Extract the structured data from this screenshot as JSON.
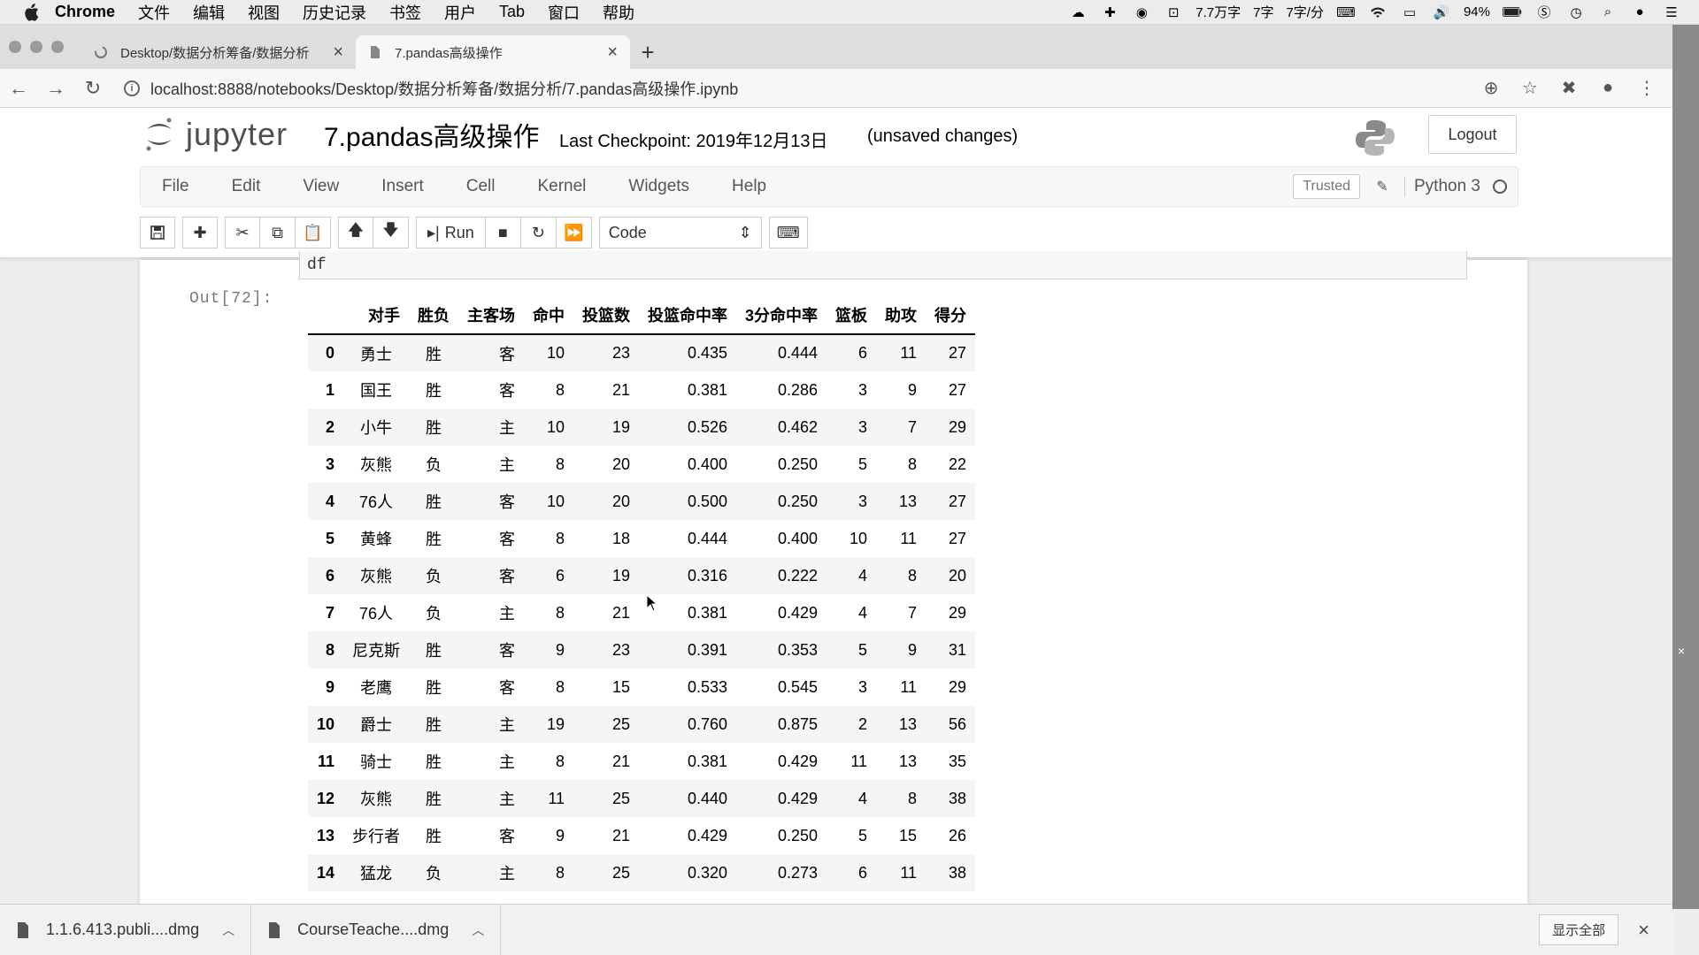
{
  "mac_menubar": {
    "app_name": "Chrome",
    "items": [
      "文件",
      "编辑",
      "视图",
      "历史记录",
      "书签",
      "用户",
      "Tab",
      "窗口",
      "帮助"
    ],
    "status": {
      "words_total": "7.7万字",
      "words_count": "7字",
      "words_rate": "7字/分",
      "battery": "94%"
    }
  },
  "browser": {
    "tabs": [
      {
        "title": "Desktop/数据分析筹备/数据分析",
        "active": false
      },
      {
        "title": "7.pandas高级操作",
        "active": true
      }
    ],
    "url": "localhost:8888/notebooks/Desktop/数据分析筹备/数据分析/7.pandas高级操作.ipynb"
  },
  "jupyter": {
    "logo_text": "jupyter",
    "notebook_name": "7.pandas高级操作",
    "checkpoint": "Last Checkpoint: 2019年12月13日",
    "unsaved": "(unsaved changes)",
    "logout_label": "Logout",
    "menu": [
      "File",
      "Edit",
      "View",
      "Insert",
      "Cell",
      "Kernel",
      "Widgets",
      "Help"
    ],
    "trusted_label": "Trusted",
    "kernel_name": "Python 3",
    "toolbar": {
      "run_label": "Run",
      "cell_type": "Code"
    }
  },
  "cell": {
    "input_code": "df",
    "out_prompt": "Out[72]:"
  },
  "dataframe": {
    "columns": [
      "",
      "对手",
      "胜负",
      "主客场",
      "命中",
      "投篮数",
      "投篮命中率",
      "3分命中率",
      "篮板",
      "助攻",
      "得分"
    ],
    "rows": [
      [
        "0",
        "勇士",
        "胜",
        "客",
        "10",
        "23",
        "0.435",
        "0.444",
        "6",
        "11",
        "27"
      ],
      [
        "1",
        "国王",
        "胜",
        "客",
        "8",
        "21",
        "0.381",
        "0.286",
        "3",
        "9",
        "27"
      ],
      [
        "2",
        "小牛",
        "胜",
        "主",
        "10",
        "19",
        "0.526",
        "0.462",
        "3",
        "7",
        "29"
      ],
      [
        "3",
        "灰熊",
        "负",
        "主",
        "8",
        "20",
        "0.400",
        "0.250",
        "5",
        "8",
        "22"
      ],
      [
        "4",
        "76人",
        "胜",
        "客",
        "10",
        "20",
        "0.500",
        "0.250",
        "3",
        "13",
        "27"
      ],
      [
        "5",
        "黄蜂",
        "胜",
        "客",
        "8",
        "18",
        "0.444",
        "0.400",
        "10",
        "11",
        "27"
      ],
      [
        "6",
        "灰熊",
        "负",
        "客",
        "6",
        "19",
        "0.316",
        "0.222",
        "4",
        "8",
        "20"
      ],
      [
        "7",
        "76人",
        "负",
        "主",
        "8",
        "21",
        "0.381",
        "0.429",
        "4",
        "7",
        "29"
      ],
      [
        "8",
        "尼克斯",
        "胜",
        "客",
        "9",
        "23",
        "0.391",
        "0.353",
        "5",
        "9",
        "31"
      ],
      [
        "9",
        "老鹰",
        "胜",
        "客",
        "8",
        "15",
        "0.533",
        "0.545",
        "3",
        "11",
        "29"
      ],
      [
        "10",
        "爵士",
        "胜",
        "主",
        "19",
        "25",
        "0.760",
        "0.875",
        "2",
        "13",
        "56"
      ],
      [
        "11",
        "骑士",
        "胜",
        "主",
        "8",
        "21",
        "0.381",
        "0.429",
        "11",
        "13",
        "35"
      ],
      [
        "12",
        "灰熊",
        "胜",
        "主",
        "11",
        "25",
        "0.440",
        "0.429",
        "4",
        "8",
        "38"
      ],
      [
        "13",
        "步行者",
        "胜",
        "客",
        "9",
        "21",
        "0.429",
        "0.250",
        "5",
        "15",
        "26"
      ],
      [
        "14",
        "猛龙",
        "负",
        "主",
        "8",
        "25",
        "0.320",
        "0.273",
        "6",
        "11",
        "38"
      ]
    ]
  },
  "downloads": {
    "items": [
      "1.1.6.413.publi....dmg",
      "CourseTeache....dmg"
    ],
    "show_all_label": "显示全部"
  }
}
